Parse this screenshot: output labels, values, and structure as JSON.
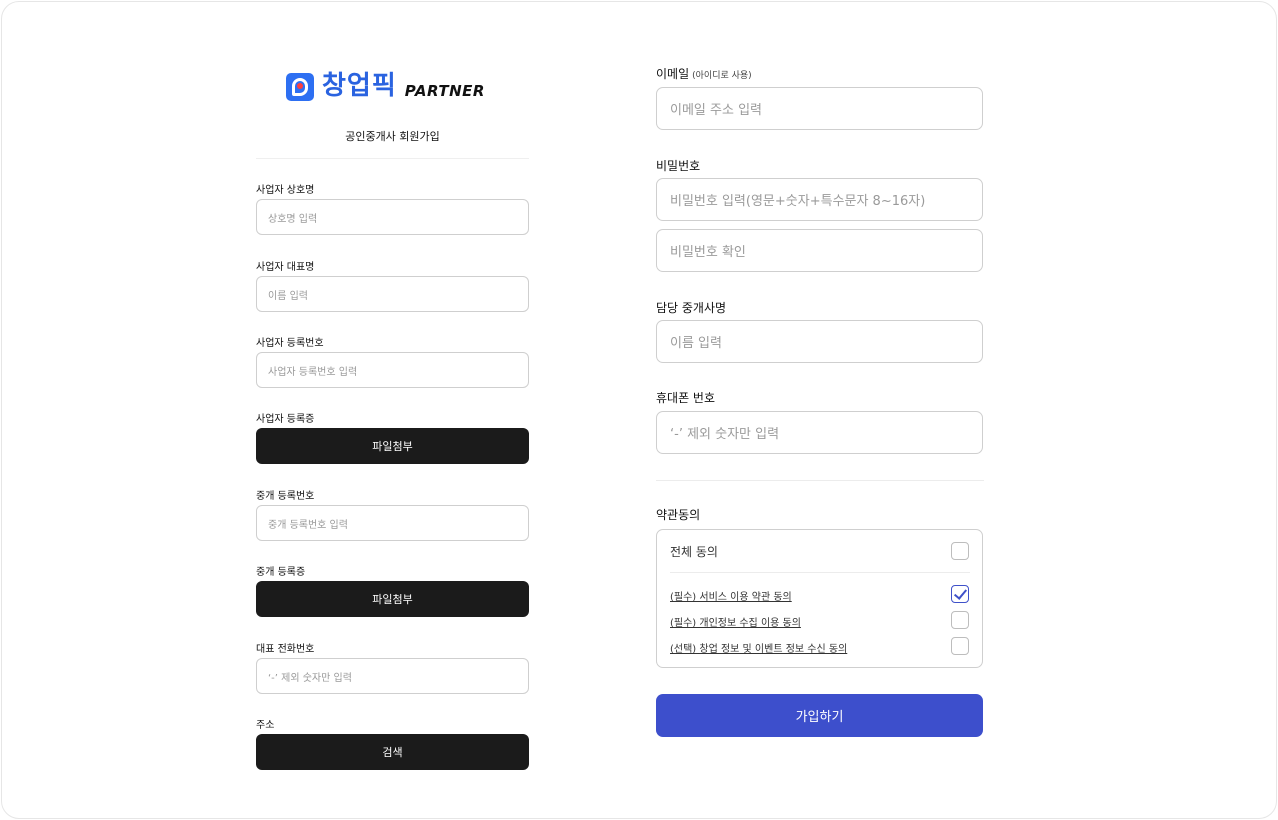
{
  "brand": {
    "name_ko": "창업픽",
    "name_en": "PARTNER",
    "accent": "#2d6ff2",
    "icon": "logo-p-icon"
  },
  "page_title": "공인중개사 회원가입",
  "left_form": {
    "company_name": {
      "label": "사업자 상호명",
      "placeholder": "상호명 입력"
    },
    "representative": {
      "label": "사업자 대표명",
      "placeholder": "이름 입력"
    },
    "business_number": {
      "label": "사업자 등록번호",
      "placeholder": "사업자 등록번호 입력"
    },
    "business_cert": {
      "label": "사업자 등록증",
      "button": "파일첨부"
    },
    "broker_number": {
      "label": "중개 등록번호",
      "placeholder": "중개 등록번호 입력"
    },
    "broker_cert": {
      "label": "중개 등록증",
      "button": "파일첨부"
    },
    "phone": {
      "label": "대표 전화번호",
      "placeholder": "‘-’ 제외 숫자만 입력"
    },
    "address": {
      "label": "주소",
      "button": "검색"
    }
  },
  "right_form": {
    "email": {
      "label": "이메일",
      "hint": "(아이디로 사용)",
      "placeholder": "이메일 주소 입력"
    },
    "password": {
      "label": "비밀번호",
      "placeholder": "비밀번호 입력(영문+숫자+특수문자 8~16자)",
      "confirm_placeholder": "비밀번호 확인"
    },
    "agent_name": {
      "label": "담당 중개사명",
      "placeholder": "이름 입력"
    },
    "mobile": {
      "label": "휴대폰 번호",
      "placeholder": "‘-’ 제외 숫자만 입력"
    }
  },
  "terms": {
    "section_label": "약관동의",
    "all_agree": "전체 동의",
    "all_checked": false,
    "items": [
      {
        "label": "(필수) 서비스 이용 약관 동의",
        "checked": true
      },
      {
        "label": "(필수) 개인정보 수집 이용 동의",
        "checked": false
      },
      {
        "label": "(선택) 창업 정보 및 이벤트 정보 수신 동의",
        "checked": false
      }
    ]
  },
  "submit_label": "가입하기",
  "colors": {
    "submit": "#3d4fcc",
    "dark_button": "#1b1b1b",
    "check": "#3f51c9"
  }
}
